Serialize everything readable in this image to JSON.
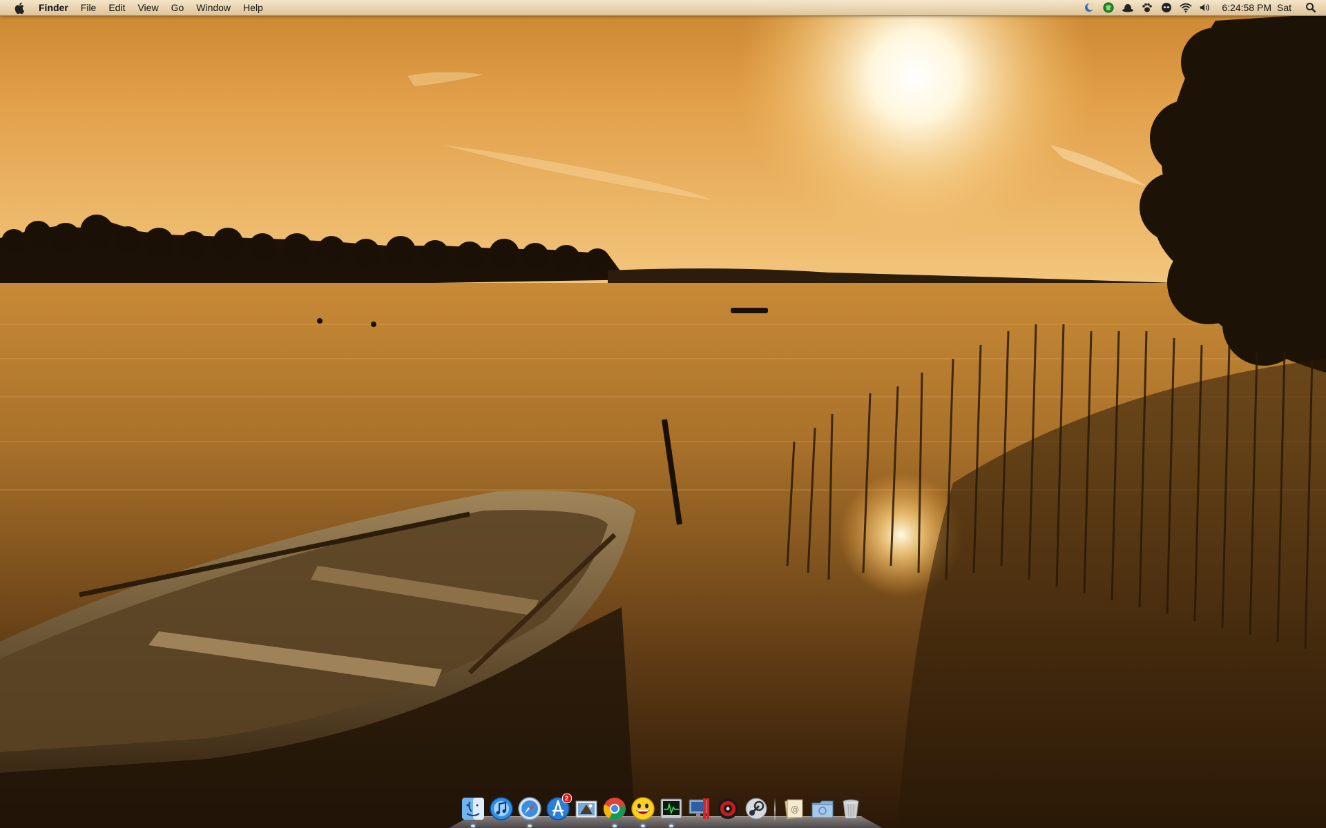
{
  "menubar": {
    "apple_icon": "apple-logo-icon",
    "app_name": "Finder",
    "menus": [
      "File",
      "Edit",
      "View",
      "Go",
      "Window",
      "Help"
    ],
    "status_icons": [
      "moon-icon",
      "green-globe-icon",
      "hat-icon",
      "paw-icon",
      "alien-face-icon",
      "wifi-icon",
      "volume-icon"
    ],
    "clock": "6:24:58 PM",
    "day": "Sat",
    "spotlight_icon": "magnifier-icon"
  },
  "dock": {
    "apps": [
      "finder-icon",
      "itunes-icon",
      "safari-icon",
      "app-store-icon",
      "mail-icon",
      "chrome-icon",
      "yahoo-messenger-icon",
      "activity-monitor-icon",
      "system-preferences-icon",
      "bittorrent-icon",
      "steam-icon"
    ],
    "app_store_badge": "2",
    "stacks": [
      "downloads-stack-icon",
      "documents-folder-icon",
      "trash-icon"
    ]
  },
  "colors": {
    "sky": "#e9a43e",
    "water": "#a56a22",
    "menubar": "#efdcb8",
    "dock_glass": "#9a9aa2"
  }
}
